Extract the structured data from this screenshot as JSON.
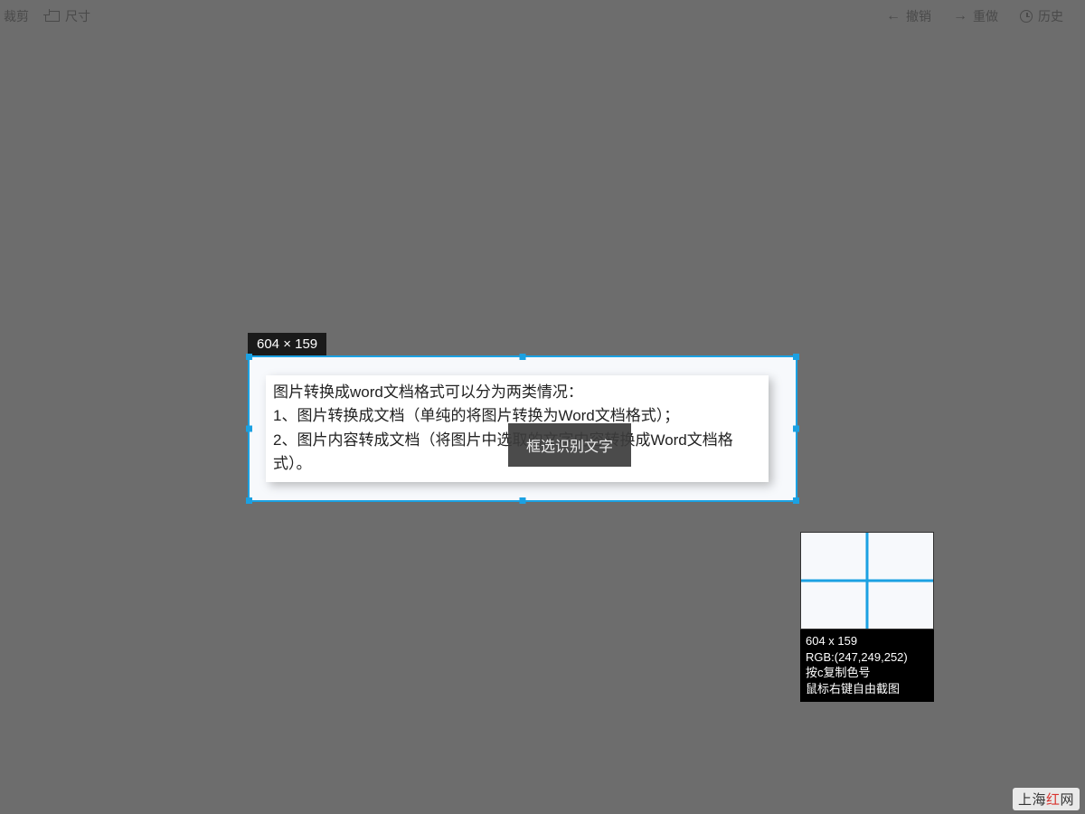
{
  "toolbar": {
    "crop": "裁剪",
    "size": "尺寸",
    "undo": "撤销",
    "redo": "重做",
    "history": "历史"
  },
  "selection": {
    "dimensions": "604 × 159",
    "lines": [
      "图片转换成word文档格式可以分为两类情况：",
      "1、图片转换成文档（单纯的将图片转换为Word文档格式）；",
      "2、图片内容转成文档（将图片中选取的文字内容转换成Word文档格式）。"
    ]
  },
  "tooltip": "框选识别文字",
  "magnifier": {
    "dimensions": "604 x 159",
    "rgb": "RGB:(247,249,252)",
    "hint1": "按c复制色号",
    "hint2": "鼠标右键自由截图"
  },
  "watermark": {
    "part1": "上海",
    "part2": "红",
    "part3": "网"
  },
  "colors": {
    "accent": "#1ba1e2",
    "background": "#6d6d6d",
    "sample_rgb": "rgb(247,249,252)"
  }
}
